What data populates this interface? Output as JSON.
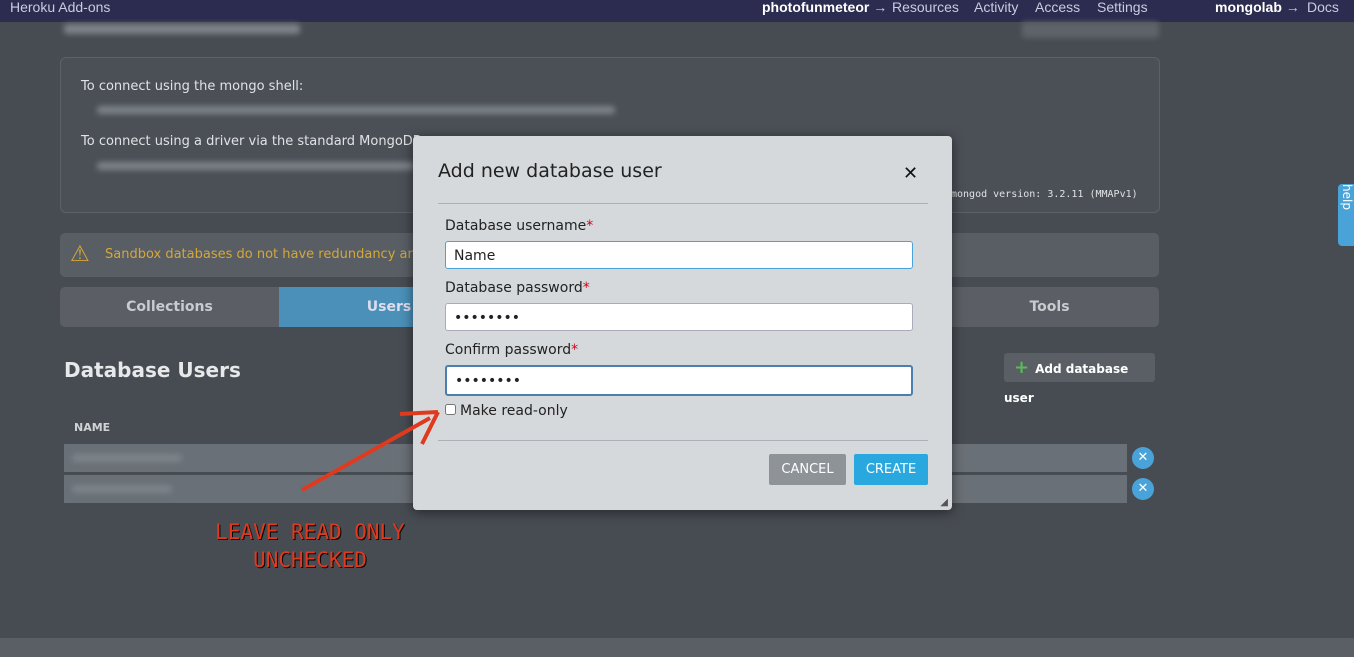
{
  "topbar": {
    "brand": "Heroku Add-ons",
    "app": "photofunmeteor",
    "arrow": "→",
    "links": [
      "Resources",
      "Activity",
      "Access",
      "Settings"
    ],
    "addon": "mongolab",
    "docs": "Docs"
  },
  "panel": {
    "shell_label": "To connect using the mongo shell:",
    "driver_label": "To connect using a driver via the standard MongoDB",
    "version": "mongod version: 3.2.11 (MMAPv1)"
  },
  "warning": {
    "text": "Sandbox databases do not have redundancy and there",
    "color": "#d4a73a"
  },
  "tabs": [
    {
      "label": "Collections"
    },
    {
      "label": "Users",
      "active": true
    },
    {
      "label": "Tools"
    }
  ],
  "users": {
    "title": "Database Users",
    "add_label": "Add database user",
    "col_name": "NAME"
  },
  "help": "help",
  "modal": {
    "title": "Add new database user",
    "username_label": "Database username",
    "username_value": "Name",
    "password_label": "Database password",
    "password_value": "••••••••",
    "confirm_label": "Confirm password",
    "confirm_value": "••••••••",
    "readonly_label": "Make read-only",
    "readonly_checked": false,
    "cancel": "CANCEL",
    "create": "CREATE"
  },
  "annotation": {
    "line1": "LEAVE READ ONLY",
    "line2": "UNCHECKED",
    "color": "#e03a1e"
  }
}
